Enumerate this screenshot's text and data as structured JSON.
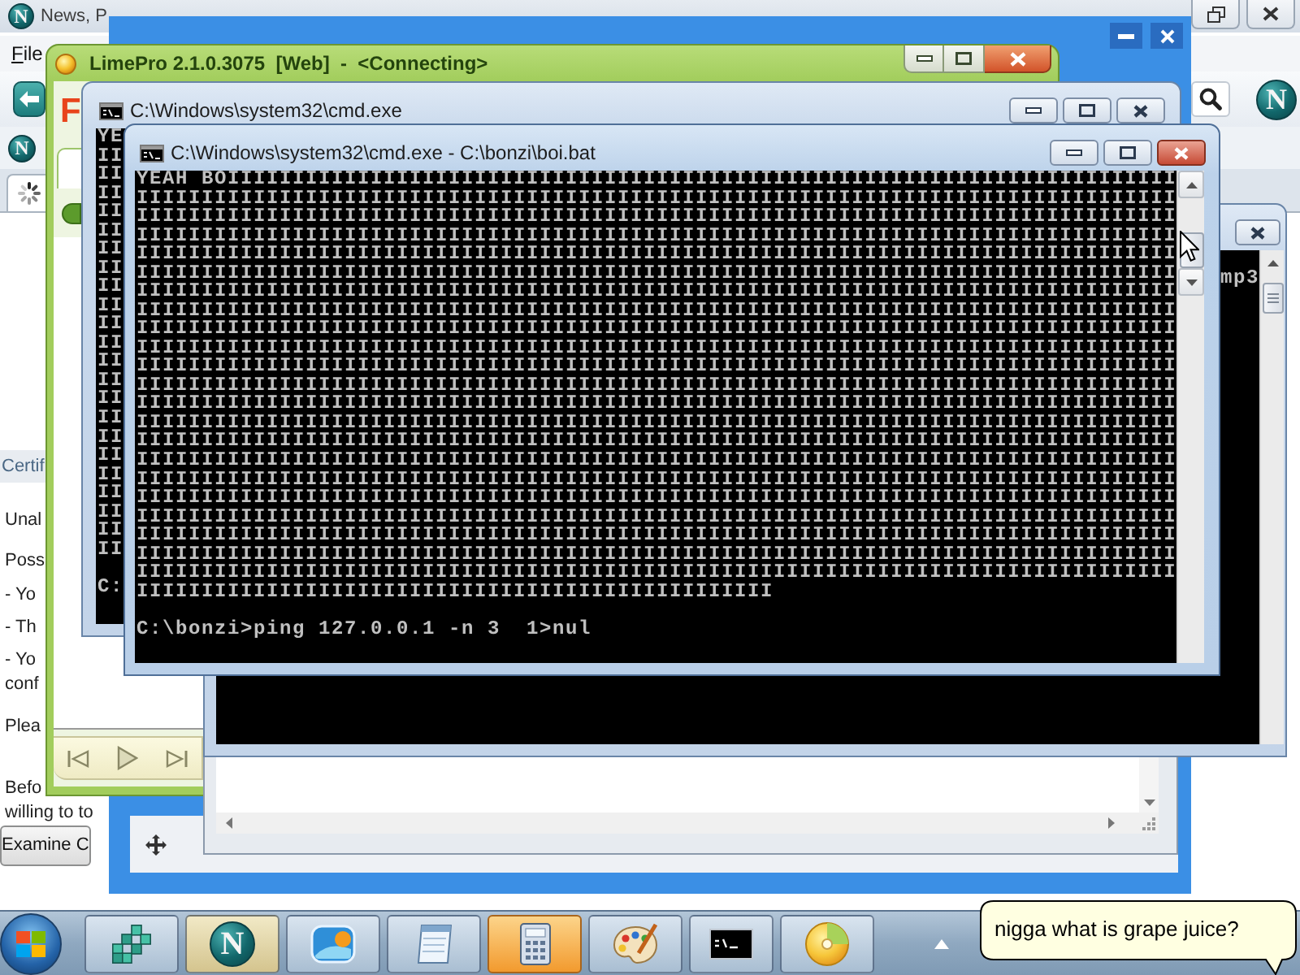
{
  "browser": {
    "title_logo": "N",
    "title": "News, P",
    "menu": [
      "File"
    ],
    "toolbar_logo": "N",
    "bookmarks_logo": "N",
    "page": {
      "heading": "Certif",
      "lines": [
        "Unal",
        "Poss",
        "- Yo",
        "- Th",
        "- Yo",
        "conf",
        "Plea",
        "Befo",
        "willing to to"
      ],
      "button": "Examine C"
    }
  },
  "limepro": {
    "title": "LimePro 2.1.0.3075  [Web]  -  <Connecting>",
    "logo": "F"
  },
  "console_back": {
    "active": false,
    "title": "C:\\Windows\\system32\\cmd.exe",
    "output": [
      "YE",
      "II",
      "II",
      "II",
      "II",
      "II",
      "II",
      "II",
      "II",
      "II",
      "II",
      "II",
      "II",
      "II",
      "II",
      "II",
      "II",
      "II",
      "II",
      "II",
      "II",
      "II",
      "II"
    ],
    "prompt": "C:"
  },
  "console_front": {
    "active": true,
    "title": "C:\\Windows\\system32\\cmd.exe - C:\\bonzi\\boi.bat",
    "output": [
      "YEAH BOIIIIIIIIIIIIIIIIIIIIIIIIIIIIIIIIIIIIIIIIIIIIIIIIIIIIIIIIIIIIIIIIIIIIIIIII",
      "IIIIIIIIIIIIIIIIIIIIIIIIIIIIIIIIIIIIIIIIIIIIIIIIIIIIIIIIIIIIIIIIIIIIIIIIIIIIIIII",
      "IIIIIIIIIIIIIIIIIIIIIIIIIIIIIIIIIIIIIIIIIIIIIIIIIIIIIIIIIIIIIIIIIIIIIIIIIIIIIIII",
      "IIIIIIIIIIIIIIIIIIIIIIIIIIIIIIIIIIIIIIIIIIIIIIIIIIIIIIIIIIIIIIIIIIIIIIIIIIIIIIII",
      "IIIIIIIIIIIIIIIIIIIIIIIIIIIIIIIIIIIIIIIIIIIIIIIIIIIIIIIIIIIIIIIIIIIIIIIIIIIIIIII",
      "IIIIIIIIIIIIIIIIIIIIIIIIIIIIIIIIIIIIIIIIIIIIIIIIIIIIIIIIIIIIIIIIIIIIIIIIIIIIIIII",
      "IIIIIIIIIIIIIIIIIIIIIIIIIIIIIIIIIIIIIIIIIIIIIIIIIIIIIIIIIIIIIIIIIIIIIIIIIIIIIIII",
      "IIIIIIIIIIIIIIIIIIIIIIIIIIIIIIIIIIIIIIIIIIIIIIIIIIIIIIIIIIIIIIIIIIIIIIIIIIIIIIII",
      "IIIIIIIIIIIIIIIIIIIIIIIIIIIIIIIIIIIIIIIIIIIIIIIIIIIIIIIIIIIIIIIIIIIIIIIIIIIIIIII",
      "IIIIIIIIIIIIIIIIIIIIIIIIIIIIIIIIIIIIIIIIIIIIIIIIIIIIIIIIIIIIIIIIIIIIIIIIIIIIIIII",
      "IIIIIIIIIIIIIIIIIIIIIIIIIIIIIIIIIIIIIIIIIIIIIIIIIIIIIIIIIIIIIIIIIIIIIIIIIIIIIIII",
      "IIIIIIIIIIIIIIIIIIIIIIIIIIIIIIIIIIIIIIIIIIIIIIIIIIIIIIIIIIIIIIIIIIIIIIIIIIIIIIII",
      "IIIIIIIIIIIIIIIIIIIIIIIIIIIIIIIIIIIIIIIIIIIIIIIIIIIIIIIIIIIIIIIIIIIIIIIIIIIIIIII",
      "IIIIIIIIIIIIIIIIIIIIIIIIIIIIIIIIIIIIIIIIIIIIIIIIIIIIIIIIIIIIIIIIIIIIIIIIIIIIIIII",
      "IIIIIIIIIIIIIIIIIIIIIIIIIIIIIIIIIIIIIIIIIIIIIIIIIIIIIIIIIIIIIIIIIIIIIIIIIIIIIIII",
      "IIIIIIIIIIIIIIIIIIIIIIIIIIIIIIIIIIIIIIIIIIIIIIIIIIIIIIIIIIIIIIIIIIIIIIIIIIIIIIII",
      "IIIIIIIIIIIIIIIIIIIIIIIIIIIIIIIIIIIIIIIIIIIIIIIIIIIIIIIIIIIIIIIIIIIIIIIIIIIIIIII",
      "IIIIIIIIIIIIIIIIIIIIIIIIIIIIIIIIIIIIIIIIIIIIIIIIIIIIIIIIIIIIIIIIIIIIIIIIIIIIIIII",
      "IIIIIIIIIIIIIIIIIIIIIIIIIIIIIIIIIIIIIIIIIIIIIIIIIIIIIIIIIIIIIIIIIIIIIIIIIIIIIIII",
      "IIIIIIIIIIIIIIIIIIIIIIIIIIIIIIIIIIIIIIIIIIIIIIIIIIIIIIIIIIIIIIIIIIIIIIIIIIIIIIII",
      "IIIIIIIIIIIIIIIIIIIIIIIIIIIIIIIIIIIIIIIIIIIIIIIIIIIIIIIIIIIIIIIIIIIIIIIIIIIIIIII",
      "IIIIIIIIIIIIIIIIIIIIIIIIIIIIIIIIIIIIIIIIIIIIIIIIIIIIIIIIIIIIIIIIIIIIIIIIIIIIIIII",
      "IIIIIIIIIIIIIIIIIIIIIIIIIIIIIIIIIIIIIIIIIIIIIIIII"
    ],
    "prompt": "C:\\bonzi>ping 127.0.0.1 -n 3  1>nul"
  },
  "console_right": {
    "active": false,
    "output": [
      "mp3"
    ]
  },
  "taskbar": {
    "buttons": [
      {
        "kind": "registry",
        "active": false,
        "flashing": false
      },
      {
        "kind": "netscape",
        "active": true,
        "flashing": false,
        "logo": "N"
      },
      {
        "kind": "photos",
        "active": false,
        "flashing": false
      },
      {
        "kind": "notepad",
        "active": false,
        "flashing": false
      },
      {
        "kind": "calculator",
        "active": false,
        "flashing": true
      },
      {
        "kind": "paint",
        "active": false,
        "flashing": false
      },
      {
        "kind": "console",
        "active": false,
        "flashing": false
      },
      {
        "kind": "disc",
        "active": false,
        "flashing": false
      }
    ]
  },
  "balloon": {
    "text": "nigga what is grape juice?"
  }
}
